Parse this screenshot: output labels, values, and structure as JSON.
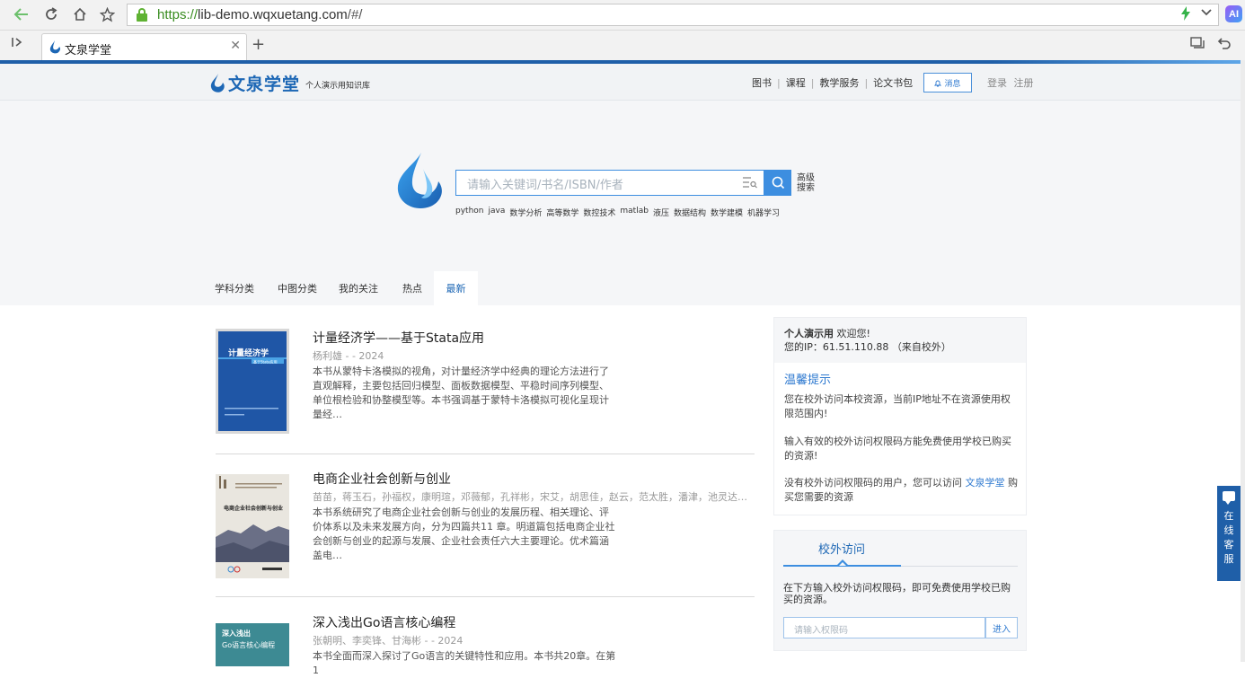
{
  "browser": {
    "url_scheme": "https://",
    "url_host": "lib-demo.wqxuetang.com",
    "url_path": "/#/",
    "tab_title": "文泉学堂",
    "ai_label": "AI",
    "icons": [
      "back-icon",
      "reload-icon",
      "home-icon",
      "star-icon",
      "lock-icon",
      "bolt-icon",
      "dropdown-icon",
      "sidebar-toggle-icon",
      "close-icon",
      "new-tab-icon",
      "tab-manager-icon",
      "undo-icon"
    ]
  },
  "site": {
    "brand_name": "文泉学堂",
    "brand_slogan": "个人演示用知识库",
    "nav": [
      "图书",
      "课程",
      "教学服务",
      "论文书包"
    ],
    "message_label": "消息",
    "login_label": "登录",
    "register_label": "注册",
    "accent_color": "#1f5fa8"
  },
  "search": {
    "placeholder": "请输入关键词/书名/ISBN/作者",
    "advanced_line1": "高级",
    "advanced_line2": "搜索",
    "hot_words": [
      "python",
      "java",
      "数学分析",
      "高等数学",
      "数控技术",
      "matlab",
      "液压",
      "数据结构",
      "数学建模",
      "机器学习"
    ]
  },
  "tabs": [
    "学科分类",
    "中图分类",
    "我的关注",
    "热点",
    "最新"
  ],
  "active_tab": "最新",
  "books": [
    {
      "title": "计量经济学——基于Stata应用",
      "authors": "杨利雄 - - 2024",
      "desc": "本书从蒙特卡洛模拟的视角，对计量经济学中经典的理论方法进行了直观解释，主要包括回归模型、面板数据模型、平稳时间序列模型、单位根检验和协整模型等。本书强调基于蒙特卡洛模拟可视化呈现计量经…",
      "cover_title": "计量经济学",
      "cover_sub": "基于Stata应用"
    },
    {
      "title": "电商企业社会创新与创业",
      "authors": "苗苗，蒋玉石，孙福权，康明瑄，邓薇郁，孔祥彬，宋艾，胡思佳，赵云，范太胜，潘津，池灵达，王…",
      "desc": "本书系统研究了电商企业社会创新与创业的发展历程、相关理论、评价体系以及未来发展方向，分为四篇共11 章。明道篇包括电商企业社会创新与创业的起源与发展、企业社会责任六大主要理论。优术篇涵盖电…",
      "cover_title": "电商企业社会创新与创业"
    },
    {
      "title": "深入浅出Go语言核心编程",
      "authors": "张朝明、李奕锋、甘海彬 - - 2024",
      "desc": "本书全面而深入探讨了Go语言的关键特性和应用。本书共20章。在第1",
      "cover_title": "深入浅出",
      "cover_sub": "Go语言核心编程"
    }
  ],
  "account": {
    "user_label": "个人演示用",
    "welcome": "欢迎您!",
    "ip_label": "您的IP：",
    "ip": "61.51.110.88",
    "ip_note": "（来自校外）",
    "tip_title": "温馨提示",
    "tip1": "您在校外访问本校资源，当前IP地址不在资源使用权限范围内!",
    "tip2": "输入有效的校外访问权限码方能免费使用学校已购买的资源!",
    "tip3_pre": "没有校外访问权限码的用户，您可以访问",
    "tip3_link": "文泉学堂",
    "tip3_post": "购买您需要的资源"
  },
  "offcampus": {
    "tab_label": "校外访问",
    "desc": "在下方输入校外访问权限码，即可免费使用学校已购买的资源。",
    "input_placeholder": "请输入权限码",
    "enter_label": "进入"
  },
  "service_label": [
    "在",
    "线",
    "客",
    "服"
  ]
}
